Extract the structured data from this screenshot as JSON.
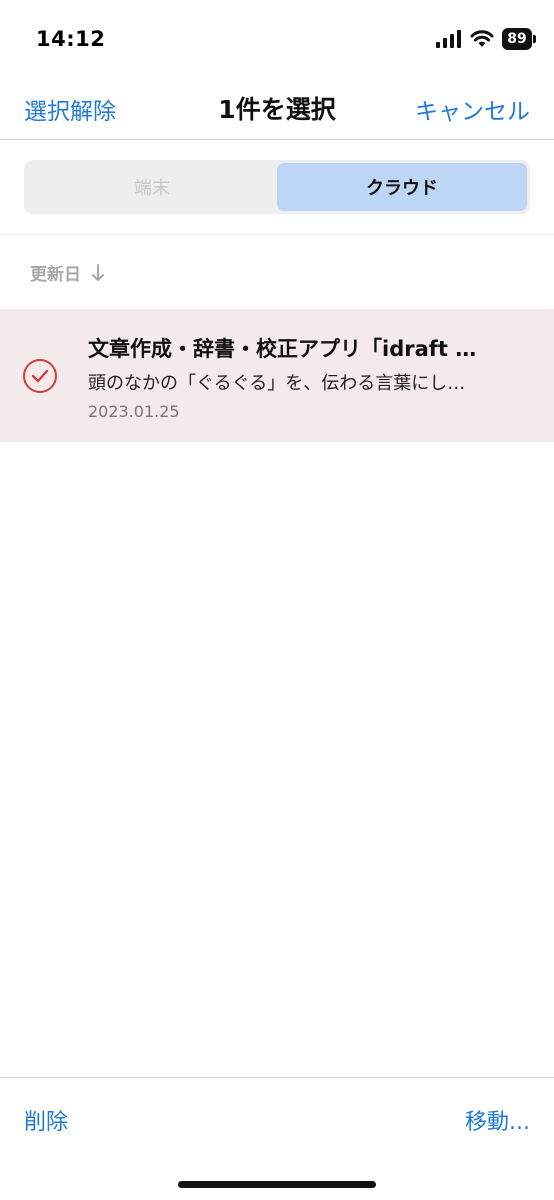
{
  "status_bar": {
    "time": "14:12",
    "battery": "89",
    "icons": [
      "signal-icon",
      "wifi-icon",
      "battery-icon"
    ]
  },
  "nav": {
    "left_label": "選択解除",
    "title": "1件を選択",
    "right_label": "キャンセル"
  },
  "segments": {
    "items": [
      "端末",
      "クラウド"
    ],
    "selected": "クラウド"
  },
  "sort": {
    "label": "更新日",
    "direction_icon": "arrow-down-icon"
  },
  "list": {
    "items": [
      {
        "title": "文章作成・辞書・校正アプリ「idraft by GOO」",
        "snippet": "頭のなかの「ぐるぐる」を、伝わる言葉にしよう",
        "date": "2023.01.25",
        "selected": true
      }
    ]
  },
  "toolbar": {
    "delete_label": "削除",
    "move_label": "移動..."
  },
  "colors": {
    "accent": "#1f7ad6",
    "selected_row_bg": "#f5eaea",
    "check_red": "#d23c3c",
    "segment_active": "#bdd6f5"
  }
}
